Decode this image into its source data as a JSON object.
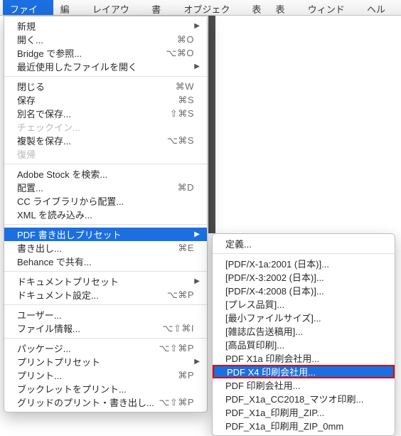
{
  "menubar": {
    "items": [
      {
        "label": "ファイル",
        "active": true
      },
      {
        "label": "編集"
      },
      {
        "label": "レイアウト"
      },
      {
        "label": "書式"
      },
      {
        "label": "オブジェクト"
      },
      {
        "label": "表"
      },
      {
        "label": "表示"
      },
      {
        "label": "ウィンドウ"
      },
      {
        "label": "ヘルプ"
      }
    ]
  },
  "file_menu": {
    "new": "新規",
    "open": "開く...",
    "open_sc": "⌘O",
    "browse_bridge": "Bridge で参照...",
    "browse_bridge_sc": "⌥⌘O",
    "recent": "最近使用したファイルを開く",
    "close": "閉じる",
    "close_sc": "⌘W",
    "save": "保存",
    "save_sc": "⌘S",
    "save_as": "別名で保存...",
    "save_as_sc": "⇧⌘S",
    "checkin": "チェックイン...",
    "save_copy": "複製を保存...",
    "save_copy_sc": "⌥⌘S",
    "revert": "復帰",
    "stock": "Adobe Stock を検索...",
    "place": "配置...",
    "place_sc": "⌘D",
    "cc_lib": "CC ライブラリから配置...",
    "xml": "XML を読み込み...",
    "pdf_preset": "PDF 書き出しプリセット",
    "export": "書き出し...",
    "export_sc": "⌘E",
    "behance": "Behance で共有...",
    "doc_preset": "ドキュメントプリセット",
    "doc_setup": "ドキュメント設定...",
    "doc_setup_sc": "⌥⌘P",
    "user": "ユーザー...",
    "file_info": "ファイル情報...",
    "file_info_sc": "⌥⇧⌘I",
    "package": "パッケージ...",
    "package_sc": "⌥⇧⌘P",
    "print_preset": "プリントプリセット",
    "print": "プリント...",
    "print_sc": "⌘P",
    "booklet": "ブックレットをプリント...",
    "grid_print": "グリッドのプリント・書き出し...",
    "grid_print_sc": "⌥⇧⌘P"
  },
  "pdf_submenu": {
    "define": "定義...",
    "x1a2001": "[PDF/X-1a:2001 (日本)]...",
    "x32002": "[PDF/X-3:2002 (日本)]...",
    "x42008": "[PDF/X-4:2008 (日本)]...",
    "press": "[プレス品質]...",
    "smallest": "[最小ファイルサイズ]...",
    "magazine": "[雑誌広告送稿用]...",
    "highqual": "[高品質印刷]...",
    "x1a_print": "PDF X1a 印刷会社用...",
    "x4_print": "PDF X4 印刷会社用...",
    "pdf_print": "PDF 印刷会社用...",
    "cc2018": "PDF_X1a_CC2018_マツオ印刷...",
    "zip": "PDF_X1a_印刷用_ZIP...",
    "zip0": "PDF_X1a_印刷用_ZIP_0mm"
  }
}
